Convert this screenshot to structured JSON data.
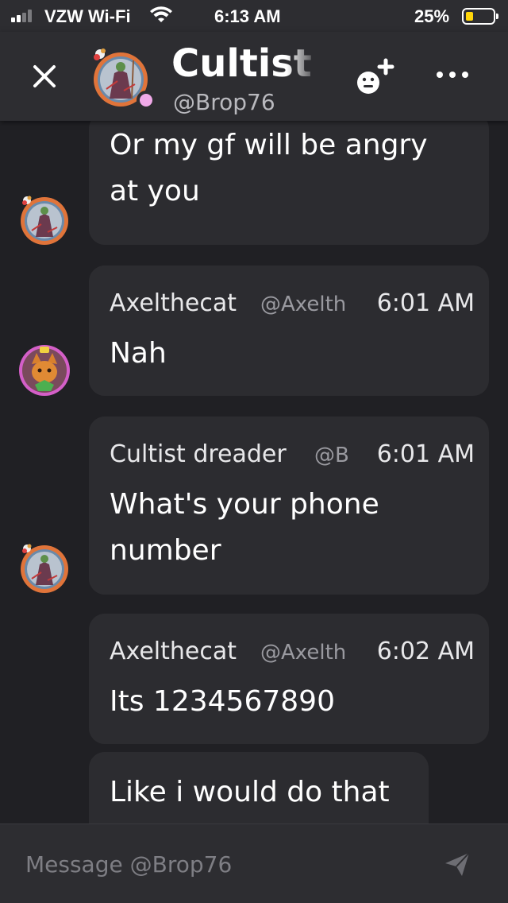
{
  "status_bar": {
    "carrier": "VZW Wi-Fi",
    "time": "6:13 AM",
    "battery_percent": "25%",
    "battery_level": 0.25,
    "signal_bars": 2,
    "icons": [
      "signal-icon",
      "wifi-icon",
      "battery-icon"
    ]
  },
  "header": {
    "title": "Cultist dreader",
    "handle": "@Brop76",
    "presence_color": "#f0a9e8",
    "icons": [
      "close-icon",
      "add-friend-icon",
      "more-icon"
    ]
  },
  "messages": [
    {
      "author": "",
      "handle": "",
      "time": "",
      "lines": [
        "Or my gf will be angry",
        "at you"
      ],
      "avatar": "cultist-avatar"
    },
    {
      "author": "Axelthecat",
      "handle": "@Axelth",
      "time": "6:01 AM",
      "lines": [
        "Nah"
      ],
      "avatar": "cat-avatar"
    },
    {
      "author": "Cultist dreader",
      "handle": "@B",
      "time": "6:01 AM",
      "lines": [
        "What's your phone",
        "number"
      ],
      "avatar": "cultist-avatar"
    },
    {
      "author": "Axelthecat",
      "handle": "@Axelth",
      "time": "6:02 AM",
      "lines": [
        "Its 1234567890"
      ],
      "avatar": ""
    },
    {
      "author": "",
      "handle": "",
      "time": "",
      "lines": [
        "Like i would do that"
      ],
      "avatar": ""
    }
  ],
  "composer": {
    "placeholder": "Message @Brop76",
    "send_icon": "send-icon"
  },
  "colors": {
    "background": "#202024",
    "header": "#2d2d31",
    "bubble": "#2c2c30",
    "battery_fill": "#ffd60a"
  }
}
